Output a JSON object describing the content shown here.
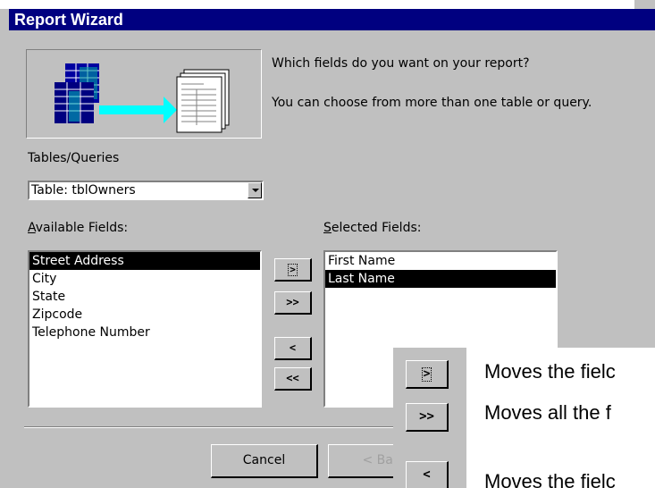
{
  "window": {
    "title": "Report Wizard"
  },
  "prompt": {
    "question": "Which fields do you want on your report?",
    "hint": "You can choose from more than one table or query."
  },
  "tables_queries": {
    "label": "Tables/Queries",
    "selected": "Table: tblOwners"
  },
  "available_fields": {
    "label_access_key": "A",
    "label_rest": "vailable Fields:",
    "items": [
      "Street Address",
      "City",
      "State",
      "Zipcode",
      "Telephone Number"
    ],
    "selected_index": 0
  },
  "selected_fields": {
    "label_access_key": "S",
    "label_rest": "elected Fields:",
    "items": [
      "First Name",
      "Last Name"
    ],
    "selected_index": 1
  },
  "move_buttons": {
    "move_one": ">",
    "move_all": ">>",
    "remove_one": "<",
    "remove_all": "<<"
  },
  "footer": {
    "cancel": "Cancel",
    "back": "< Bac"
  },
  "legend": {
    "move_one_btn": ">",
    "move_one_text": "Moves the fielc",
    "move_all_btn": ">>",
    "move_all_text": "Moves all the f",
    "remove_one_btn": "<",
    "remove_one_text": "Moves the fielc"
  },
  "icons": [
    "tables-to-report-icon"
  ]
}
